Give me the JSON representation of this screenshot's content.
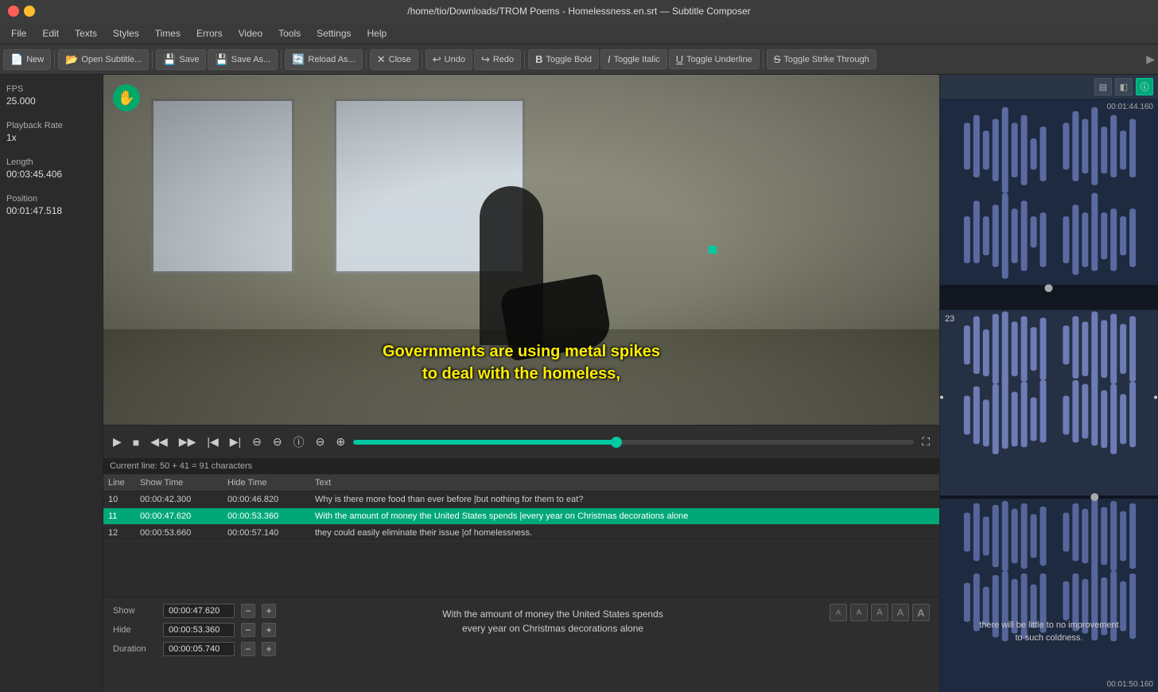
{
  "titlebar": {
    "title": "/home/tio/Downloads/TROM Poems - Homelessness.en.srt — Subtitle Composer"
  },
  "menu": {
    "items": [
      "File",
      "Edit",
      "Texts",
      "Styles",
      "Times",
      "Errors",
      "Video",
      "Tools",
      "Settings",
      "Help"
    ]
  },
  "toolbar": {
    "buttons": [
      {
        "id": "new",
        "label": "New",
        "icon": "📄"
      },
      {
        "id": "open",
        "label": "Open Subtitle...",
        "icon": "📂"
      },
      {
        "id": "save",
        "label": "Save",
        "icon": "💾"
      },
      {
        "id": "saveas",
        "label": "Save As...",
        "icon": "💾"
      },
      {
        "id": "reloadas",
        "label": "Reload As...",
        "icon": "🔄"
      },
      {
        "id": "close",
        "label": "Close",
        "icon": "✕"
      },
      {
        "id": "undo",
        "label": "Undo",
        "icon": "↩"
      },
      {
        "id": "redo",
        "label": "Redo",
        "icon": "↪"
      },
      {
        "id": "togglebold",
        "label": "Toggle Bold",
        "icon": "B"
      },
      {
        "id": "toggleitalic",
        "label": "Toggle Italic",
        "icon": "I"
      },
      {
        "id": "toggleunderline",
        "label": "Toggle Underline",
        "icon": "U"
      },
      {
        "id": "togglestrikethrough",
        "label": "Toggle Strike Through",
        "icon": "S"
      }
    ]
  },
  "left_panel": {
    "fps_label": "FPS",
    "fps_value": "25.000",
    "playback_rate_label": "Playback Rate",
    "playback_rate_value": "1x",
    "length_label": "Length",
    "length_value": "00:03:45.406",
    "position_label": "Position",
    "position_value": "00:01:47.518"
  },
  "video": {
    "subtitle_line1": "Governments are using metal spikes",
    "subtitle_line2": "to deal with the homeless,"
  },
  "playback": {
    "position_display": "00:01:47.518",
    "progress_percent": 47
  },
  "subtitle_list": {
    "headers": [
      "Line",
      "Show Time",
      "Hide Time",
      "Text"
    ],
    "rows": [
      {
        "line": "10",
        "show": "00:00:42.300",
        "hide": "00:00:46.820",
        "text": "Why is there more food than ever before |but nothing for them to eat?",
        "active": false
      },
      {
        "line": "11",
        "show": "00:00:47.620",
        "hide": "00:00:53.360",
        "text": "With the amount of money the United States spends |every year on Christmas decorations alone",
        "active": true
      },
      {
        "line": "12",
        "show": "00:00:53.660",
        "hide": "00:00:57.140",
        "text": "they could easily eliminate their issue |of homelessness.",
        "active": false
      }
    ]
  },
  "char_count": {
    "text": "Current line: 50 + 41 = 91 characters"
  },
  "edit_panel": {
    "show_label": "Show",
    "show_value": "00:00:47.620",
    "hide_label": "Hide",
    "hide_value": "00:00:53.360",
    "duration_label": "Duration",
    "duration_value": "00:00:05.740",
    "preview_line1": "With the amount of money the United States spends",
    "preview_line2": "every year on Christmas decorations alone",
    "format_buttons": [
      "A",
      "A",
      "A",
      "A",
      "A"
    ]
  },
  "waveform": {
    "timestamp_top": "00:01:44.160",
    "segment_label": "23",
    "timestamp_bottom": "00:01:50.160",
    "text_overlay_line1": "there will be little to no improvement",
    "text_overlay_line2": "to such coldness."
  }
}
